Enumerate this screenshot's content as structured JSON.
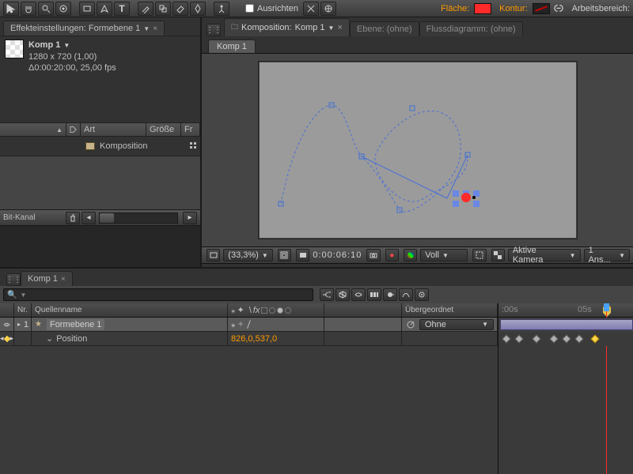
{
  "header": {
    "align_label": "Ausrichten",
    "fill_label": "Fläche:",
    "stroke_label": "Kontur:",
    "workspace_label": "Arbeitsbereich:"
  },
  "effects_panel": {
    "tab_title": "Effekteinstellungen: Formebene 1"
  },
  "project_panel": {
    "item_name": "Komp 1",
    "dimensions": "1280 x 720 (1,00)",
    "duration_fps": "Δ0:00:20:00, 25,00 fps",
    "cols": {
      "type": "Art",
      "size": "Größe",
      "fr": "Fr"
    },
    "row_name": "Komposition",
    "footer_label": "Bit-Kanal"
  },
  "comp_panel": {
    "tab_prefix": "Komposition:",
    "tab_name": "Komp 1",
    "tab_layer": "Ebene: (ohne)",
    "tab_flow": "Flussdiagramm: (ohne)",
    "subtab": "Komp 1",
    "footer": {
      "zoom": "(33,3%)",
      "timecode": "0:00:06:10",
      "res": "Voll",
      "camera": "Aktive Kamera",
      "views": "1 Ans..."
    }
  },
  "timeline": {
    "tab": "Komp 1",
    "search_placeholder": "",
    "ruler": {
      "t0": ":00s",
      "t5": "05s"
    },
    "cols": {
      "nr": "Nr.",
      "src": "Quellenname",
      "parent": "Übergeordnet"
    },
    "layer": {
      "index": "1",
      "name": "Formebene 1",
      "parent_value": "Ohne"
    },
    "prop": {
      "name": "Position",
      "value": "826,0,537,0"
    }
  }
}
